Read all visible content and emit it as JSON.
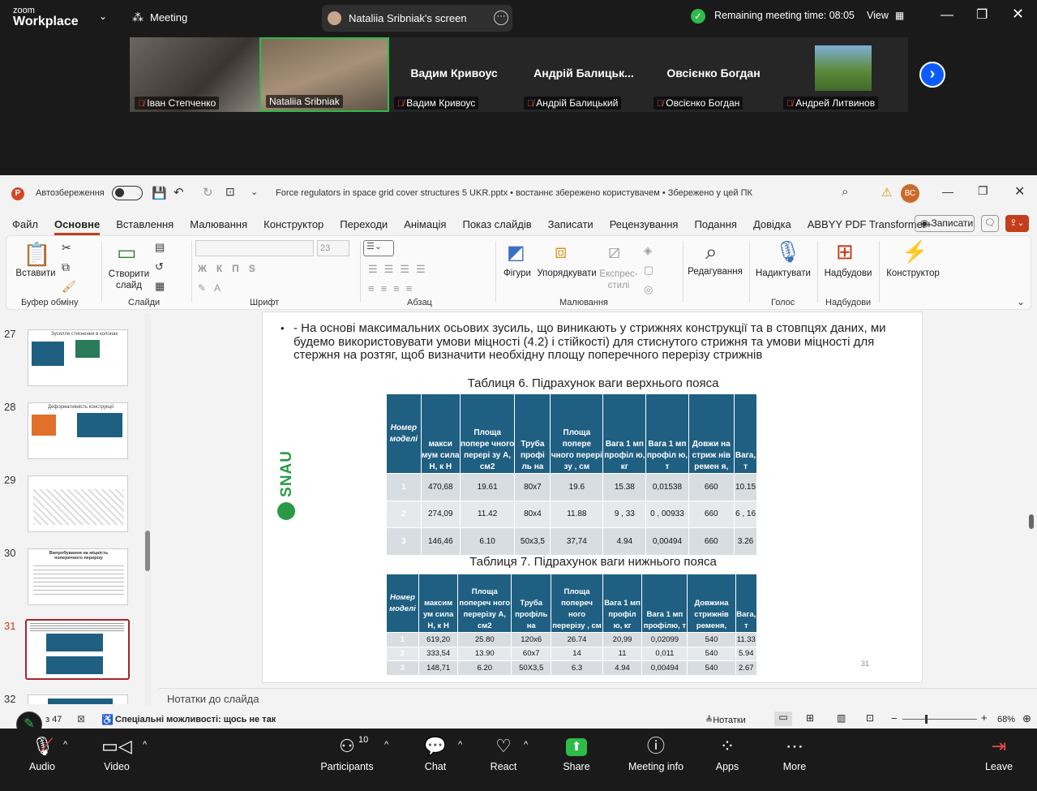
{
  "zoom": {
    "logo_line1": "zoom",
    "logo_line2": "Workplace",
    "meeting_label": "Meeting",
    "shared_screen": "Nataliia Sribniak's screen",
    "remaining_time": "Remaining meeting time: 08:05",
    "view_label": "View",
    "participants_tiles": [
      {
        "name": "Іван Степченко",
        "muted": true
      },
      {
        "name": "Nataliia Sribniak",
        "muted": false
      },
      {
        "name": "Вадим Кривоус",
        "big": "Вадим Кривоус",
        "muted": true
      },
      {
        "name": "Андрій Балицький",
        "big": "Андрій  Балицьк...",
        "muted": true
      },
      {
        "name": "Овсієнко  Богдан",
        "big": "Овсієнко  Богдан",
        "muted": true
      },
      {
        "name": "Андрей Литвинов",
        "muted": true
      }
    ],
    "toolbar": {
      "audio": "Audio",
      "video": "Video",
      "participants": "Participants",
      "participants_count": "10",
      "chat": "Chat",
      "react": "React",
      "share": "Share",
      "meeting_info": "Meeting info",
      "apps": "Apps",
      "more": "More",
      "leave": "Leave"
    }
  },
  "ppt": {
    "autosave": "Автозбереження",
    "title": "Force regulators in space grid cover structures 5 UKR.pptx  •  востаннє збережено користувачем  •  Збережено у цей ПК",
    "user_initials": "ВС",
    "menu": [
      "Файл",
      "Основне",
      "Вставлення",
      "Малювання",
      "Конструктор",
      "Переходи",
      "Анімація",
      "Показ слайдів",
      "Записати",
      "Рецензування",
      "Подання",
      "Довідка",
      "ABBYY PDF Transformer+"
    ],
    "record_button": "Записати",
    "ribbon": {
      "paste": "Вставити",
      "new_slide": "Створити слайд",
      "font_size": "23",
      "shapes": "Фігури",
      "arrange": "Упорядкувати",
      "quick_styles": "Експрес-стилі",
      "editing": "Редагування",
      "dictate": "Надиктувати",
      "addins": "Надбудови",
      "designer": "Конструктор",
      "groups": [
        "Буфер обміну",
        "Слайди",
        "Шрифт",
        "Абзац",
        "Малювання",
        "Голос",
        "Надбудови"
      ]
    },
    "thumbnails": [
      {
        "num": "27",
        "title": "Зусилля стиснення в колонах"
      },
      {
        "num": "28",
        "title": "Деформативність конструкції"
      },
      {
        "num": "29",
        "title": ""
      },
      {
        "num": "30",
        "title": "Випробування на міцність поперечного перерізу"
      },
      {
        "num": "31",
        "title": ""
      },
      {
        "num": "32",
        "title": ""
      }
    ],
    "slide": {
      "bullet": "- На основі максимальних осьових зусиль, що виникають у стрижнях конструкції та в стовпцях даних, ми будемо використовувати умови міцності (4.2) і стійкості) для стиснутого стрижня та умови міцності для стержня на розтяг, щоб визначити необхідну площу поперечного перерізу стрижнів",
      "logo_text": "SNAU",
      "page_number": "31",
      "table6": {
        "title": "Таблиця 6. Підрахунок ваги верхнього пояса",
        "headers": [
          "Номер моделі",
          "макси мум сила Н, к Н",
          "Площа попере чного перері зу А, см2",
          "Труба профі ль на",
          "Площа попере чного перері зу , см",
          "Вага 1 мп профіл ю, кг",
          "Вага 1 мп профіл ю, т",
          "Довжи на стриж нів ремен я,",
          "Вага, т"
        ],
        "rows": [
          [
            "1",
            "470,68",
            "19.61",
            "80x7",
            "19.6",
            "15.38",
            "0,01538",
            "660",
            "10.15"
          ],
          [
            "2",
            "274,09",
            "11.42",
            "80x4",
            "11.88",
            "9 , 33",
            "0 , 00933",
            "660",
            "6 , 16"
          ],
          [
            "3",
            "146,46",
            "6.10",
            "50x3,5",
            "37,74",
            "4.94",
            "0,00494",
            "660",
            "3.26"
          ]
        ]
      },
      "table7": {
        "title": "Таблиця 7. Підрахунок ваги нижнього пояса",
        "headers": [
          "Номер моделі",
          "максим ум сила Н, к Н",
          "Площа попереч ного перерізу А, см2",
          "Труба профіль на",
          "Площа попереч ного перерізу , см",
          "Вага 1 мп профіл ю, кг",
          "Вага 1 мп профілю, т",
          "Довжина стрижнів ременя,",
          "Вага, т"
        ],
        "rows": [
          [
            "1",
            "619,20",
            "25.80",
            "120x6",
            "26.74",
            "20,99",
            "0,02099",
            "540",
            "11.33"
          ],
          [
            "2",
            "333,54",
            "13.90",
            "60x7",
            "14",
            "11",
            "0,011",
            "540",
            "5.94"
          ],
          [
            "3",
            "148,71",
            "6.20",
            "50X3,5",
            "6.3",
            "4.94",
            "0,00494",
            "540",
            "2.67"
          ]
        ]
      }
    },
    "notes_placeholder": "Нотатки до слайда",
    "status": {
      "slide_count": "з 47",
      "accessibility": "Спеціальні можливості: щось не так",
      "notes": "Нотатки",
      "zoom": "68%"
    }
  }
}
